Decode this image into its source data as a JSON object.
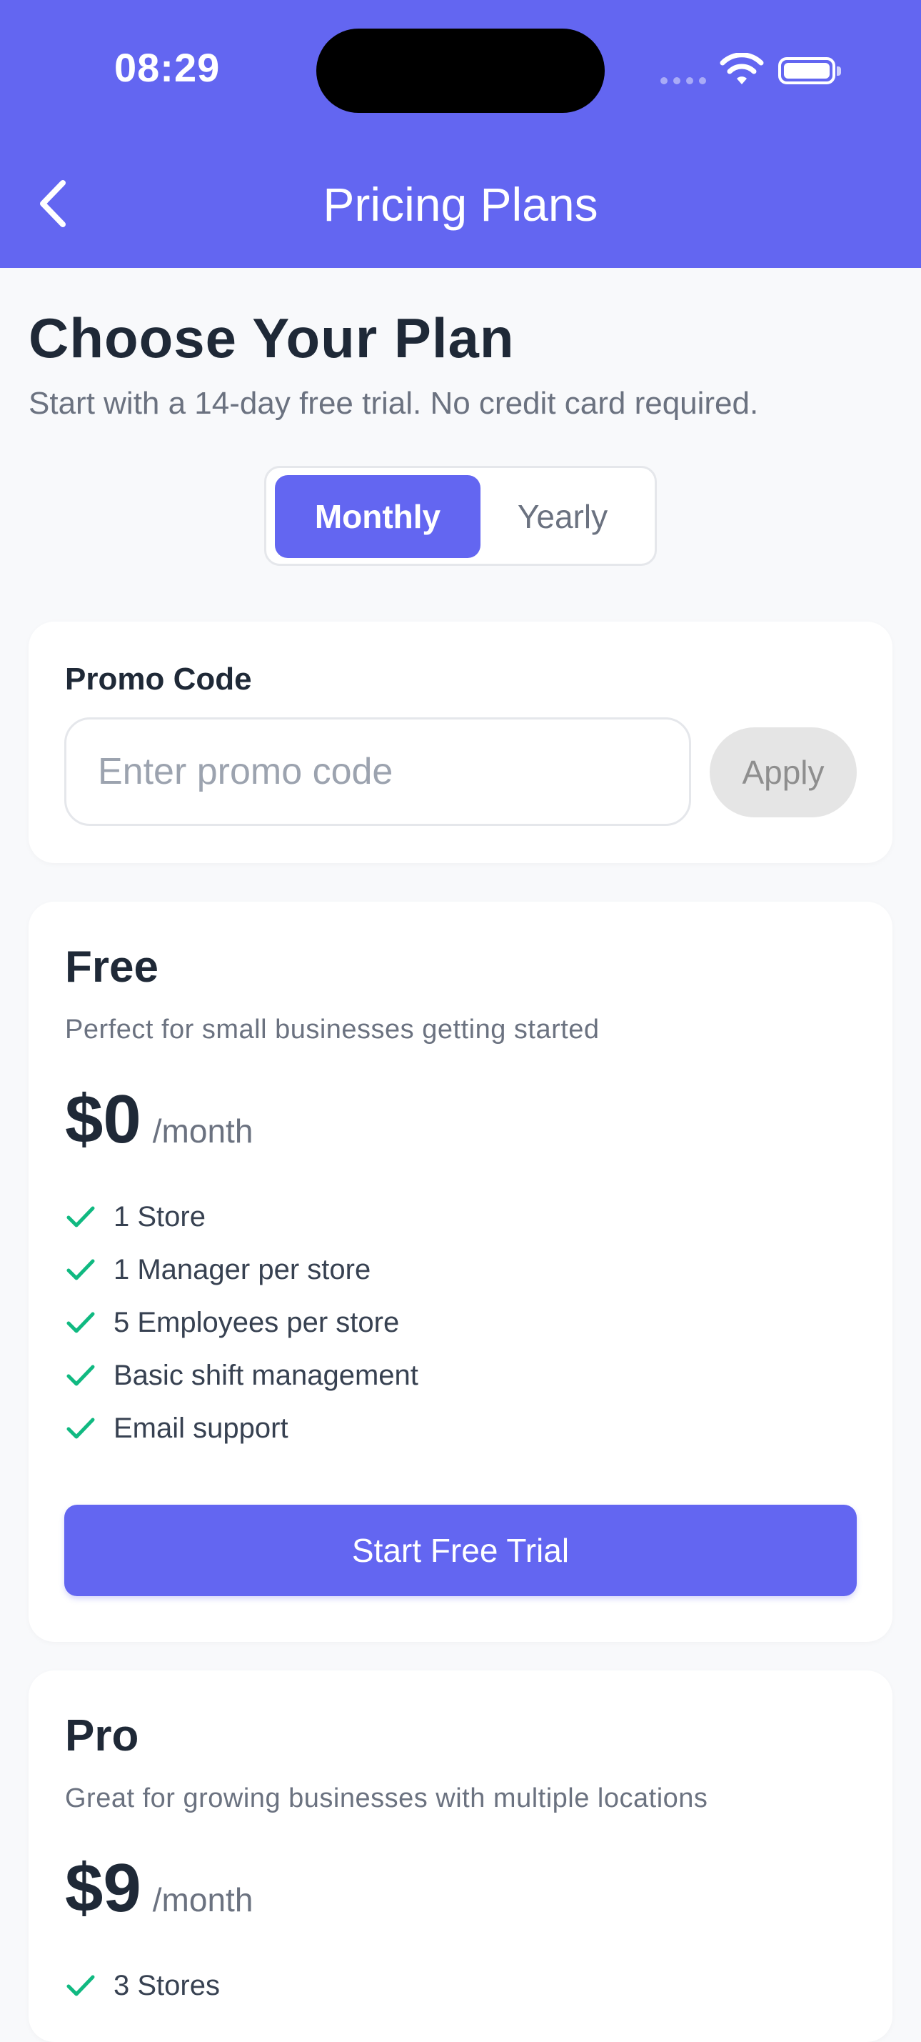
{
  "status_bar": {
    "time": "08:29"
  },
  "nav": {
    "title": "Pricing Plans"
  },
  "intro": {
    "heading": "Choose Your Plan",
    "subtitle": "Start with a 14-day free trial. No credit card required."
  },
  "billing_toggle": {
    "monthly": "Monthly",
    "yearly": "Yearly",
    "selected": "Monthly"
  },
  "promo": {
    "label": "Promo Code",
    "placeholder": "Enter promo code",
    "value": "",
    "apply": "Apply"
  },
  "plans": [
    {
      "name": "Free",
      "description": "Perfect for small businesses getting started",
      "price": "$0",
      "period": "/month",
      "features": [
        "1 Store",
        "1 Manager per store",
        "5 Employees per store",
        "Basic shift management",
        "Email support"
      ],
      "cta": "Start Free Trial"
    },
    {
      "name": "Pro",
      "description": "Great for growing businesses with multiple locations",
      "price": "$9",
      "period": "/month",
      "features": [
        "3 Stores"
      ]
    }
  ],
  "colors": {
    "primary": "#6366f1",
    "check": "#10b981",
    "text": "#1f2937",
    "muted": "#6b7280"
  },
  "icons": {
    "back": "chevron-left-icon",
    "check": "check-icon",
    "wifi": "wifi-icon",
    "battery": "battery-icon"
  }
}
